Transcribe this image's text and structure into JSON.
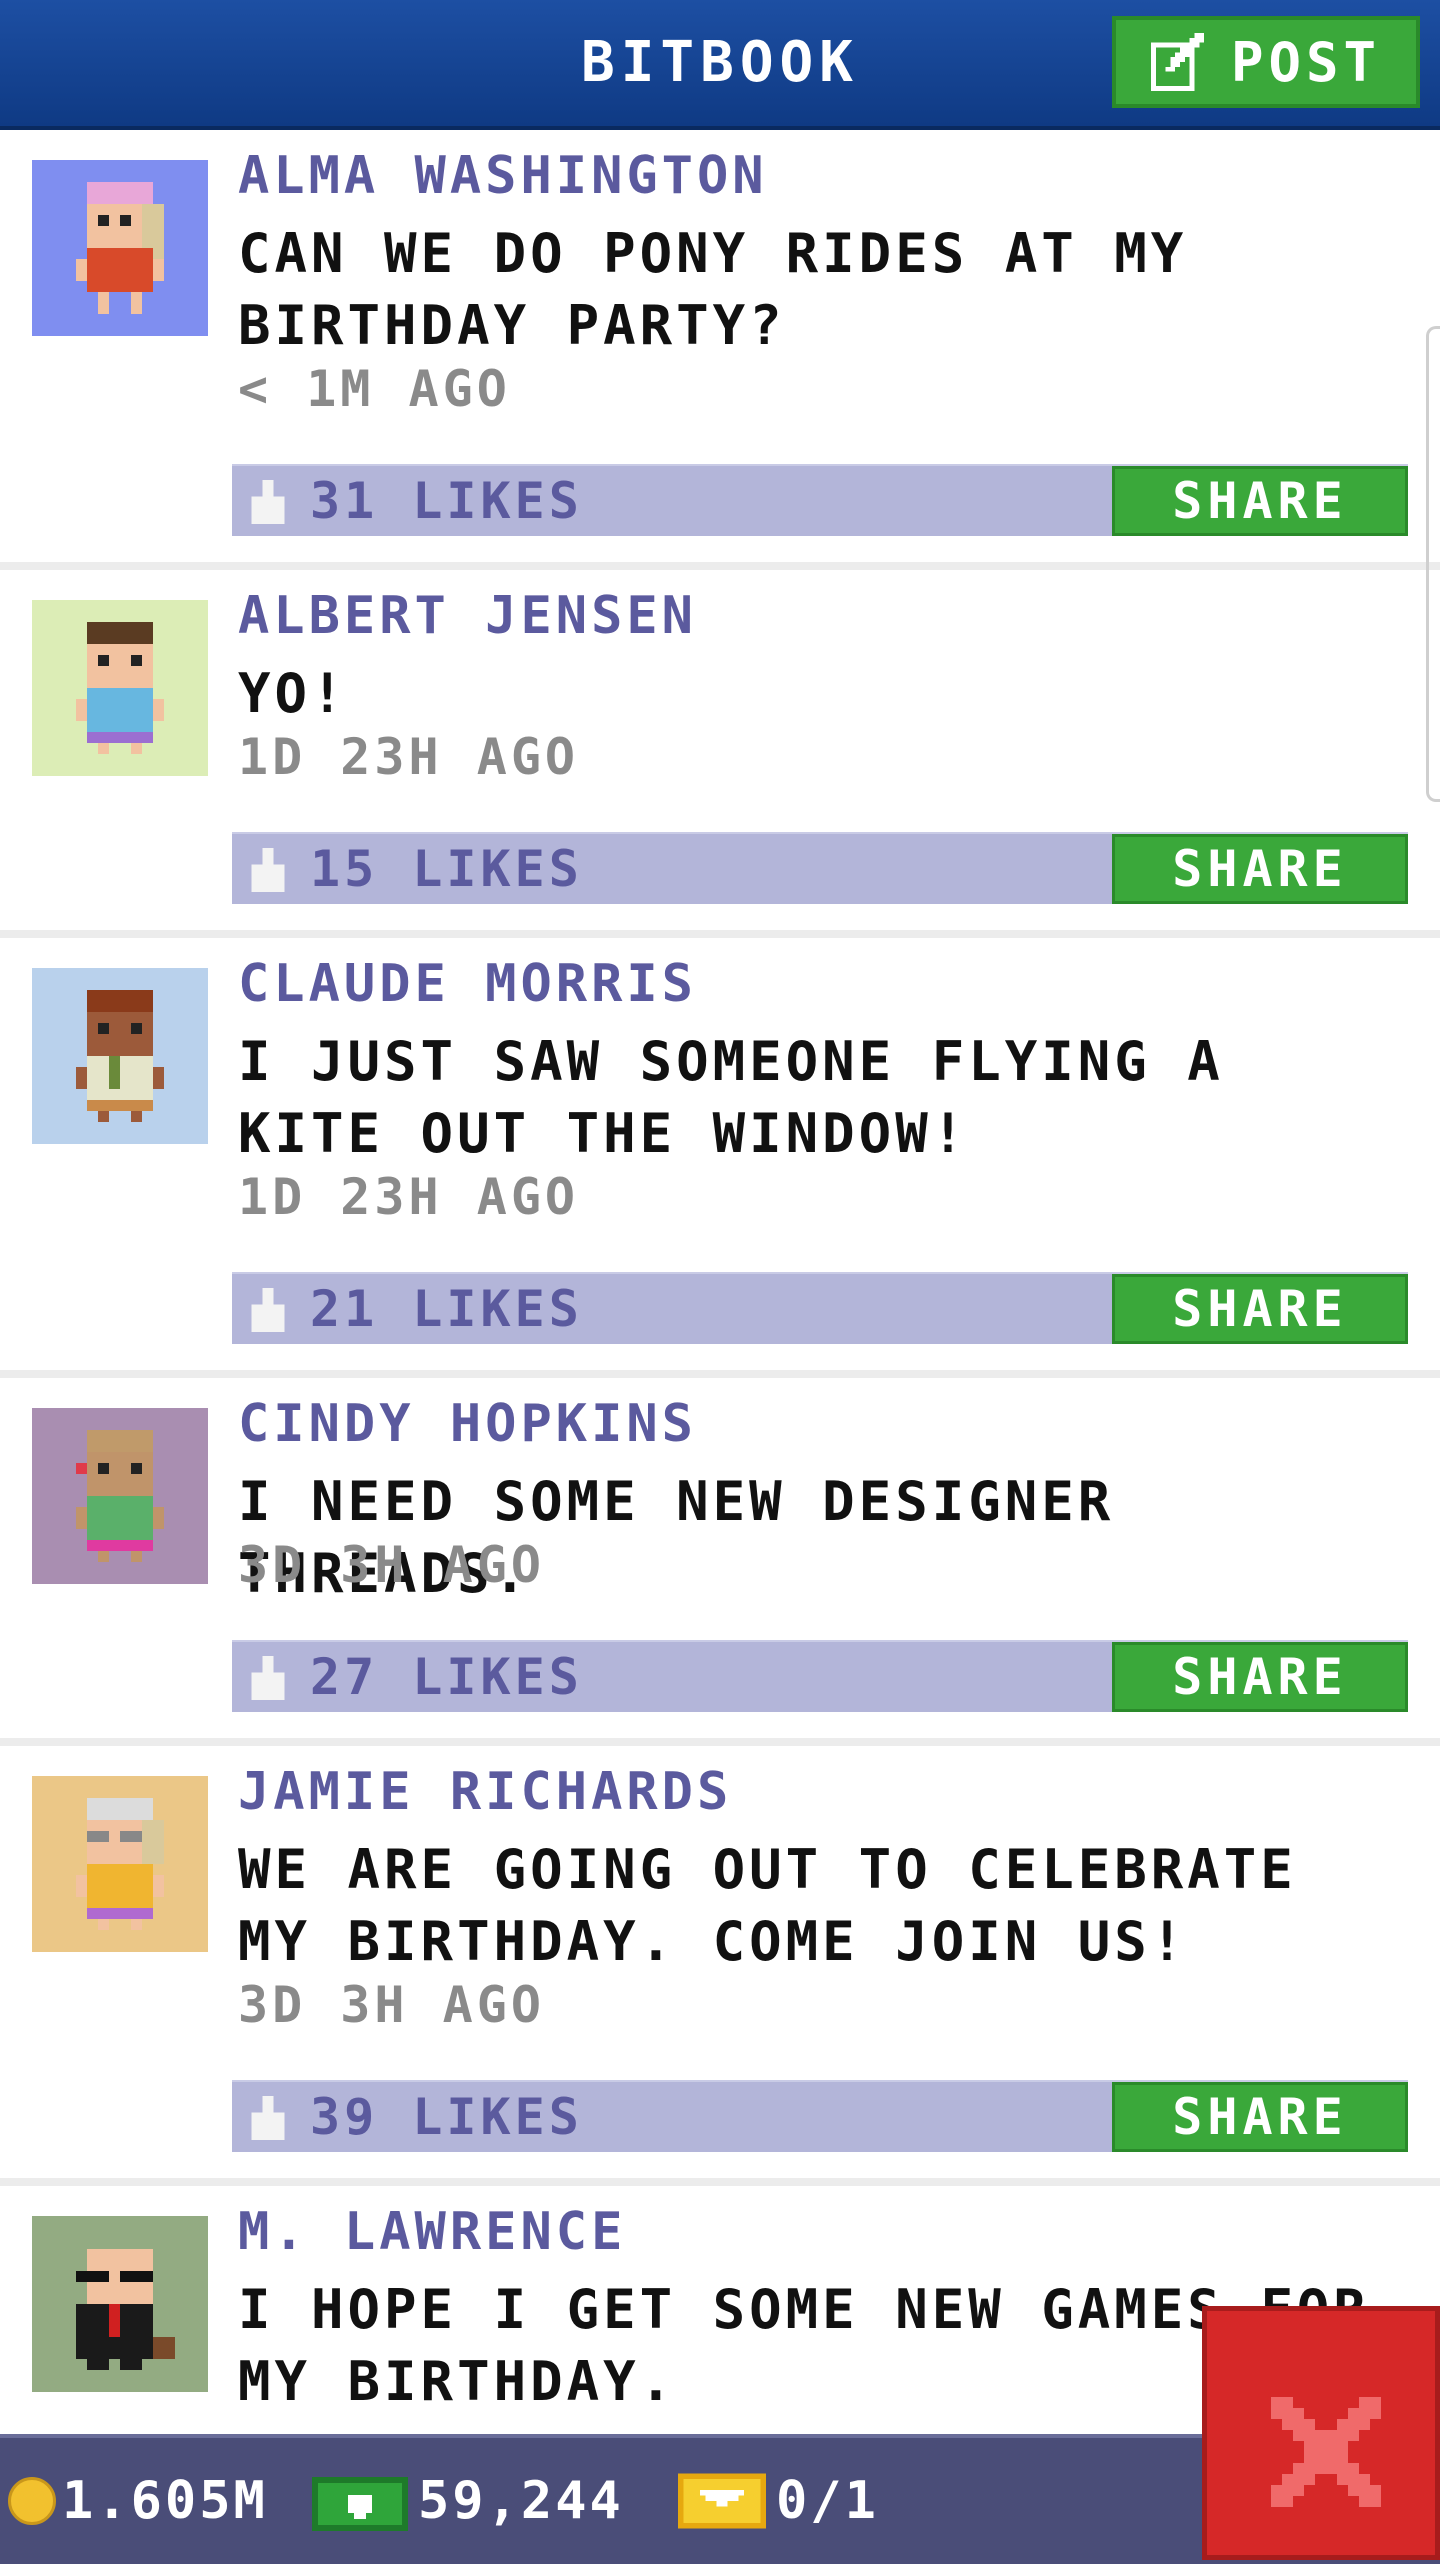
{
  "header": {
    "title": "BITBOOK",
    "post_label": "POST"
  },
  "posts": [
    {
      "name": "ALMA WASHINGTON",
      "message": "CAN WE DO PONY RIDES AT MY BIRTHDAY PARTY?",
      "time": "< 1M AGO",
      "likes": "31 LIKES",
      "share_label": "SHARE",
      "avatar_bg": "#7f8ef0"
    },
    {
      "name": "ALBERT JENSEN",
      "message": "YO!",
      "time": "1D 23H AGO",
      "likes": "15 LIKES",
      "share_label": "SHARE",
      "avatar_bg": "#dcedb6"
    },
    {
      "name": "CLAUDE MORRIS",
      "message": "I JUST SAW SOMEONE FLYING A KITE OUT THE WINDOW!",
      "time": "1D 23H AGO",
      "likes": "21 LIKES",
      "share_label": "SHARE",
      "avatar_bg": "#b9d1ec"
    },
    {
      "name": "CINDY HOPKINS",
      "message": "I NEED SOME NEW DESIGNER THREADS.",
      "time": "3D 3H AGO",
      "likes": "27 LIKES",
      "share_label": "SHARE",
      "avatar_bg": "#a98eb1"
    },
    {
      "name": "JAMIE RICHARDS",
      "message": "WE ARE GOING OUT TO CELEBRATE MY BIRTHDAY. COME JOIN US!",
      "time": "3D 3H AGO",
      "likes": "39 LIKES",
      "share_label": "SHARE",
      "avatar_bg": "#ebc787"
    },
    {
      "name": "M. LAWRENCE",
      "message": "I HOPE I GET SOME NEW GAMES FOR MY BIRTHDAY.",
      "avatar_bg": "#93ab82"
    }
  ],
  "footer": {
    "coins": "1.605M",
    "bux": "59,244",
    "tickets": "0/1"
  },
  "colors": {
    "header": "#1d4fa3",
    "green": "#3aa83a",
    "name_purple": "#5b5a9e",
    "likebar": "#b3b5d9",
    "footer": "#4a4d78",
    "close_red": "#d62828"
  }
}
